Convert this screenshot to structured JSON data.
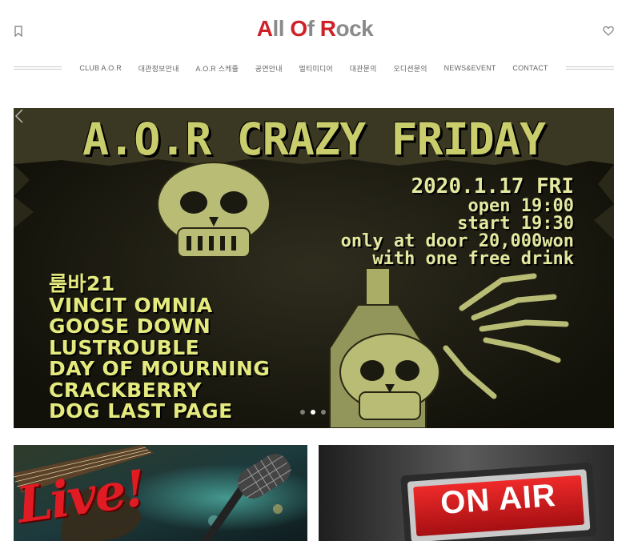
{
  "header": {
    "logo": {
      "part1_red": "A",
      "part1_grey": "ll ",
      "part2_red": "O",
      "part2_grey": "f ",
      "part3_red": "R",
      "part3_grey": "ock"
    },
    "left_icon": "bookmark-icon",
    "right_icon": "heart-icon"
  },
  "nav": {
    "items": [
      {
        "label": "CLUB A.O.R"
      },
      {
        "label": "대관정보안내"
      },
      {
        "label": "A.O.R 스케쥴"
      },
      {
        "label": "공연안내"
      },
      {
        "label": "멀티미디어"
      },
      {
        "label": "대관문의"
      },
      {
        "label": "오디션문의"
      },
      {
        "label": "NEWS&EVENT"
      },
      {
        "label": "CONTACT"
      }
    ]
  },
  "hero": {
    "title": "A.O.R CRAZY FRIDAY",
    "date": "2020.1.17 FRI",
    "open": "open 19:00",
    "start": "start 19:30",
    "price": "only at door 20,000won",
    "drink": "with one free drink",
    "lineup": [
      "룸바21",
      "VINCIT OMNIA",
      "GOOSE DOWN",
      "LUSTROUBLE",
      "DAY OF MOURNING",
      "CRACKBERRY",
      "DOG LAST PAGE"
    ],
    "slide_count": 3,
    "active_slide": 1,
    "prev_icon": "chevron-left-icon"
  },
  "cards": {
    "live": {
      "text": "Live!"
    },
    "onair": {
      "text": "ON AIR"
    }
  },
  "colors": {
    "logo_red": "#cf2027",
    "logo_grey": "#8a8a8a",
    "poster_yellow": "#c9cd6c",
    "live_red": "#e01b23"
  }
}
